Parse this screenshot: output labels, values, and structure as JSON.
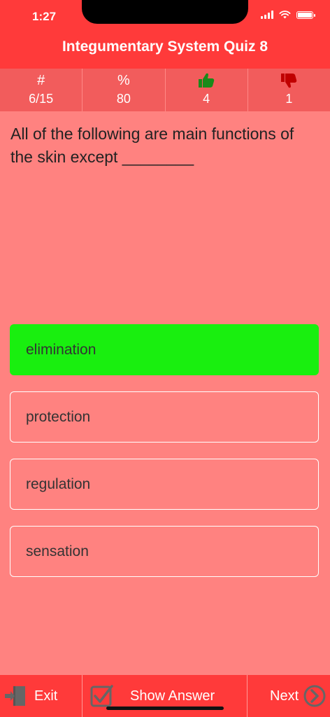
{
  "status_bar": {
    "time": "1:27"
  },
  "header": {
    "title": "Integumentary System Quiz 8"
  },
  "stats": [
    {
      "symbol": "#",
      "value": "6/15",
      "icon": "hash-icon"
    },
    {
      "symbol": "%",
      "value": "80",
      "icon": "percent-icon"
    },
    {
      "symbol": "",
      "value": "4",
      "icon": "thumbs-up-icon",
      "color": "#1a8a1a"
    },
    {
      "symbol": "",
      "value": "1",
      "icon": "thumbs-down-icon",
      "color": "#c00000"
    }
  ],
  "question": {
    "text": "All of the following are main functions of the skin except ________"
  },
  "answers": [
    {
      "label": "elimination",
      "state": "correct"
    },
    {
      "label": "protection",
      "state": "normal"
    },
    {
      "label": "regulation",
      "state": "normal"
    },
    {
      "label": "sensation",
      "state": "normal"
    }
  ],
  "bottom_bar": {
    "exit_label": "Exit",
    "show_answer_label": "Show Answer",
    "next_label": "Next"
  },
  "colors": {
    "header_bg": "#ff3a3a",
    "stats_bg": "#f25c5c",
    "page_bg": "#ff8280",
    "correct_bg": "#19ef0f"
  }
}
